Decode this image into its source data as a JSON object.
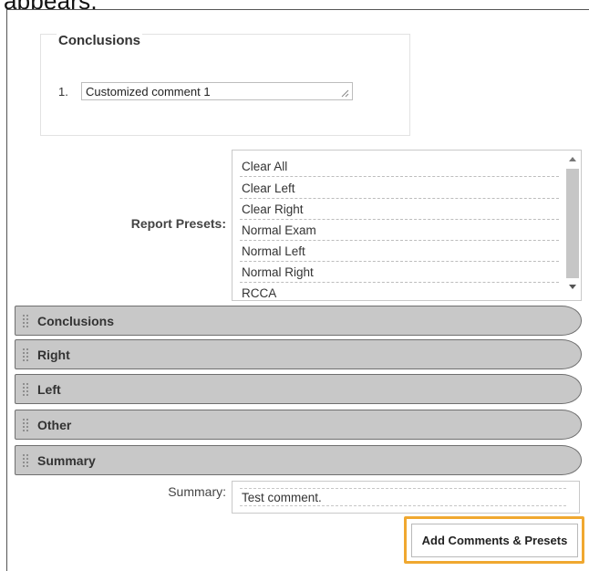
{
  "header_caption": "appears.",
  "conclusions_panel": {
    "title": "Conclusions",
    "items": [
      {
        "number": "1.",
        "value": "Customized comment 1"
      }
    ]
  },
  "report_presets": {
    "label": "Report Presets:",
    "options": [
      "Clear All",
      "Clear Left",
      "Clear Right",
      "Normal Exam",
      "Normal Left",
      "Normal Right",
      "RCCA"
    ]
  },
  "sections": [
    "Conclusions",
    "Right",
    "Left",
    "Other",
    "Summary"
  ],
  "summary": {
    "label": "Summary:",
    "value": "Test comment."
  },
  "add_button_label": "Add Comments & Presets",
  "colors": {
    "section_bar": "#c8c8c8",
    "highlight": "#f0a830"
  }
}
